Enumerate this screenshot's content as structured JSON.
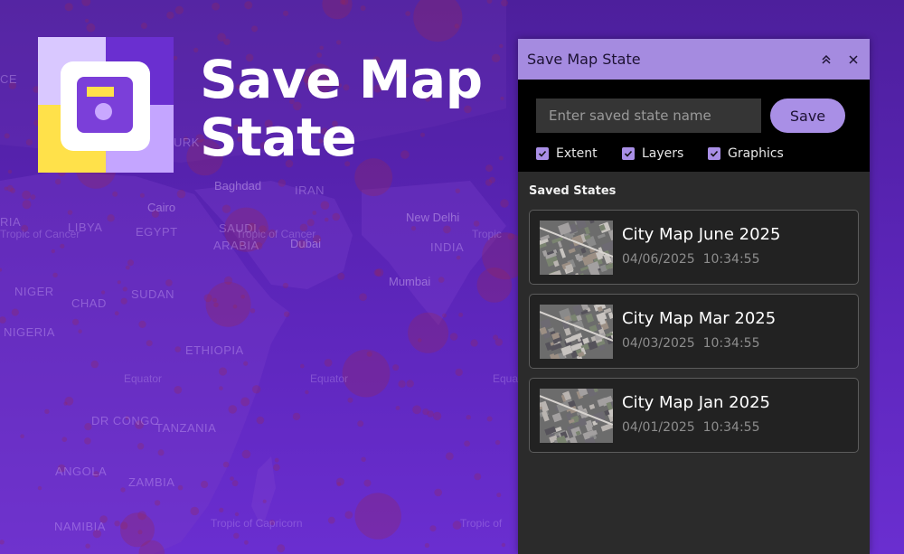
{
  "map": {
    "labels": {
      "cairo": "Cairo",
      "libya": "LIBYA",
      "egypt": "EGYPT",
      "baghdad": "Baghdad",
      "iran": "IRAN",
      "saudi": "SAUDI",
      "arabia": "ARABIA",
      "dubai": "Dubai",
      "new_delhi": "New Delhi",
      "india": "INDIA",
      "mumbai": "Mumbai",
      "niger": "NIGER",
      "chad": "CHAD",
      "sudan": "SUDAN",
      "ethiopia": "ETHIOPIA",
      "nigeria": "NIGERIA",
      "dr_congo": "DR CONGO",
      "tanzania": "TANZANIA",
      "angola": "ANGOLA",
      "zambia": "ZAMBIA",
      "namibia": "NAMIBIA",
      "urk": "URK",
      "ce": "CE",
      "ria": "RIA",
      "tropic_cancer_left": "Tropic of Cancer",
      "tropic_cancer_mid": "Tropic of Cancer",
      "tropic_cancer_right": "Tropic",
      "equator_1": "Equator",
      "equator_2": "Equator",
      "equator_3": "Equa",
      "tropic_capricorn_1": "Tropic of Capricorn",
      "tropic_capricorn_2": "Tropic of"
    }
  },
  "hero": {
    "title_line1": "Save Map",
    "title_line2": "State",
    "logo_colors": {
      "top_left": "#d9c8ff",
      "top_right": "#6a2fd0",
      "bottom_left": "#ffe14a",
      "bottom_right": "#c4a5ff",
      "disk": "#7b3fd9",
      "disk_bar": "#ffe14a",
      "disk_dot": "#c9a8ff"
    }
  },
  "panel": {
    "title": "Save Map State",
    "collapse_icon": "chevrons-up-icon",
    "close_icon": "close-icon",
    "input": {
      "placeholder": "Enter saved state name",
      "value": ""
    },
    "save_label": "Save",
    "options": [
      {
        "label": "Extent",
        "checked": true
      },
      {
        "label": "Layers",
        "checked": true
      },
      {
        "label": "Graphics",
        "checked": true
      }
    ],
    "saved_heading": "Saved States",
    "states": [
      {
        "name": "City Map June 2025",
        "date": "04/06/2025",
        "time": "10:34:55"
      },
      {
        "name": "City Map Mar 2025",
        "date": "04/03/2025",
        "time": "10:34:55"
      },
      {
        "name": "City Map Jan 2025",
        "date": "04/01/2025",
        "time": "10:34:55"
      }
    ],
    "colors": {
      "header": "#a58be0",
      "accent": "#a98fe6",
      "panel_bg": "#2b2b2b",
      "top_bg": "#000000"
    }
  }
}
